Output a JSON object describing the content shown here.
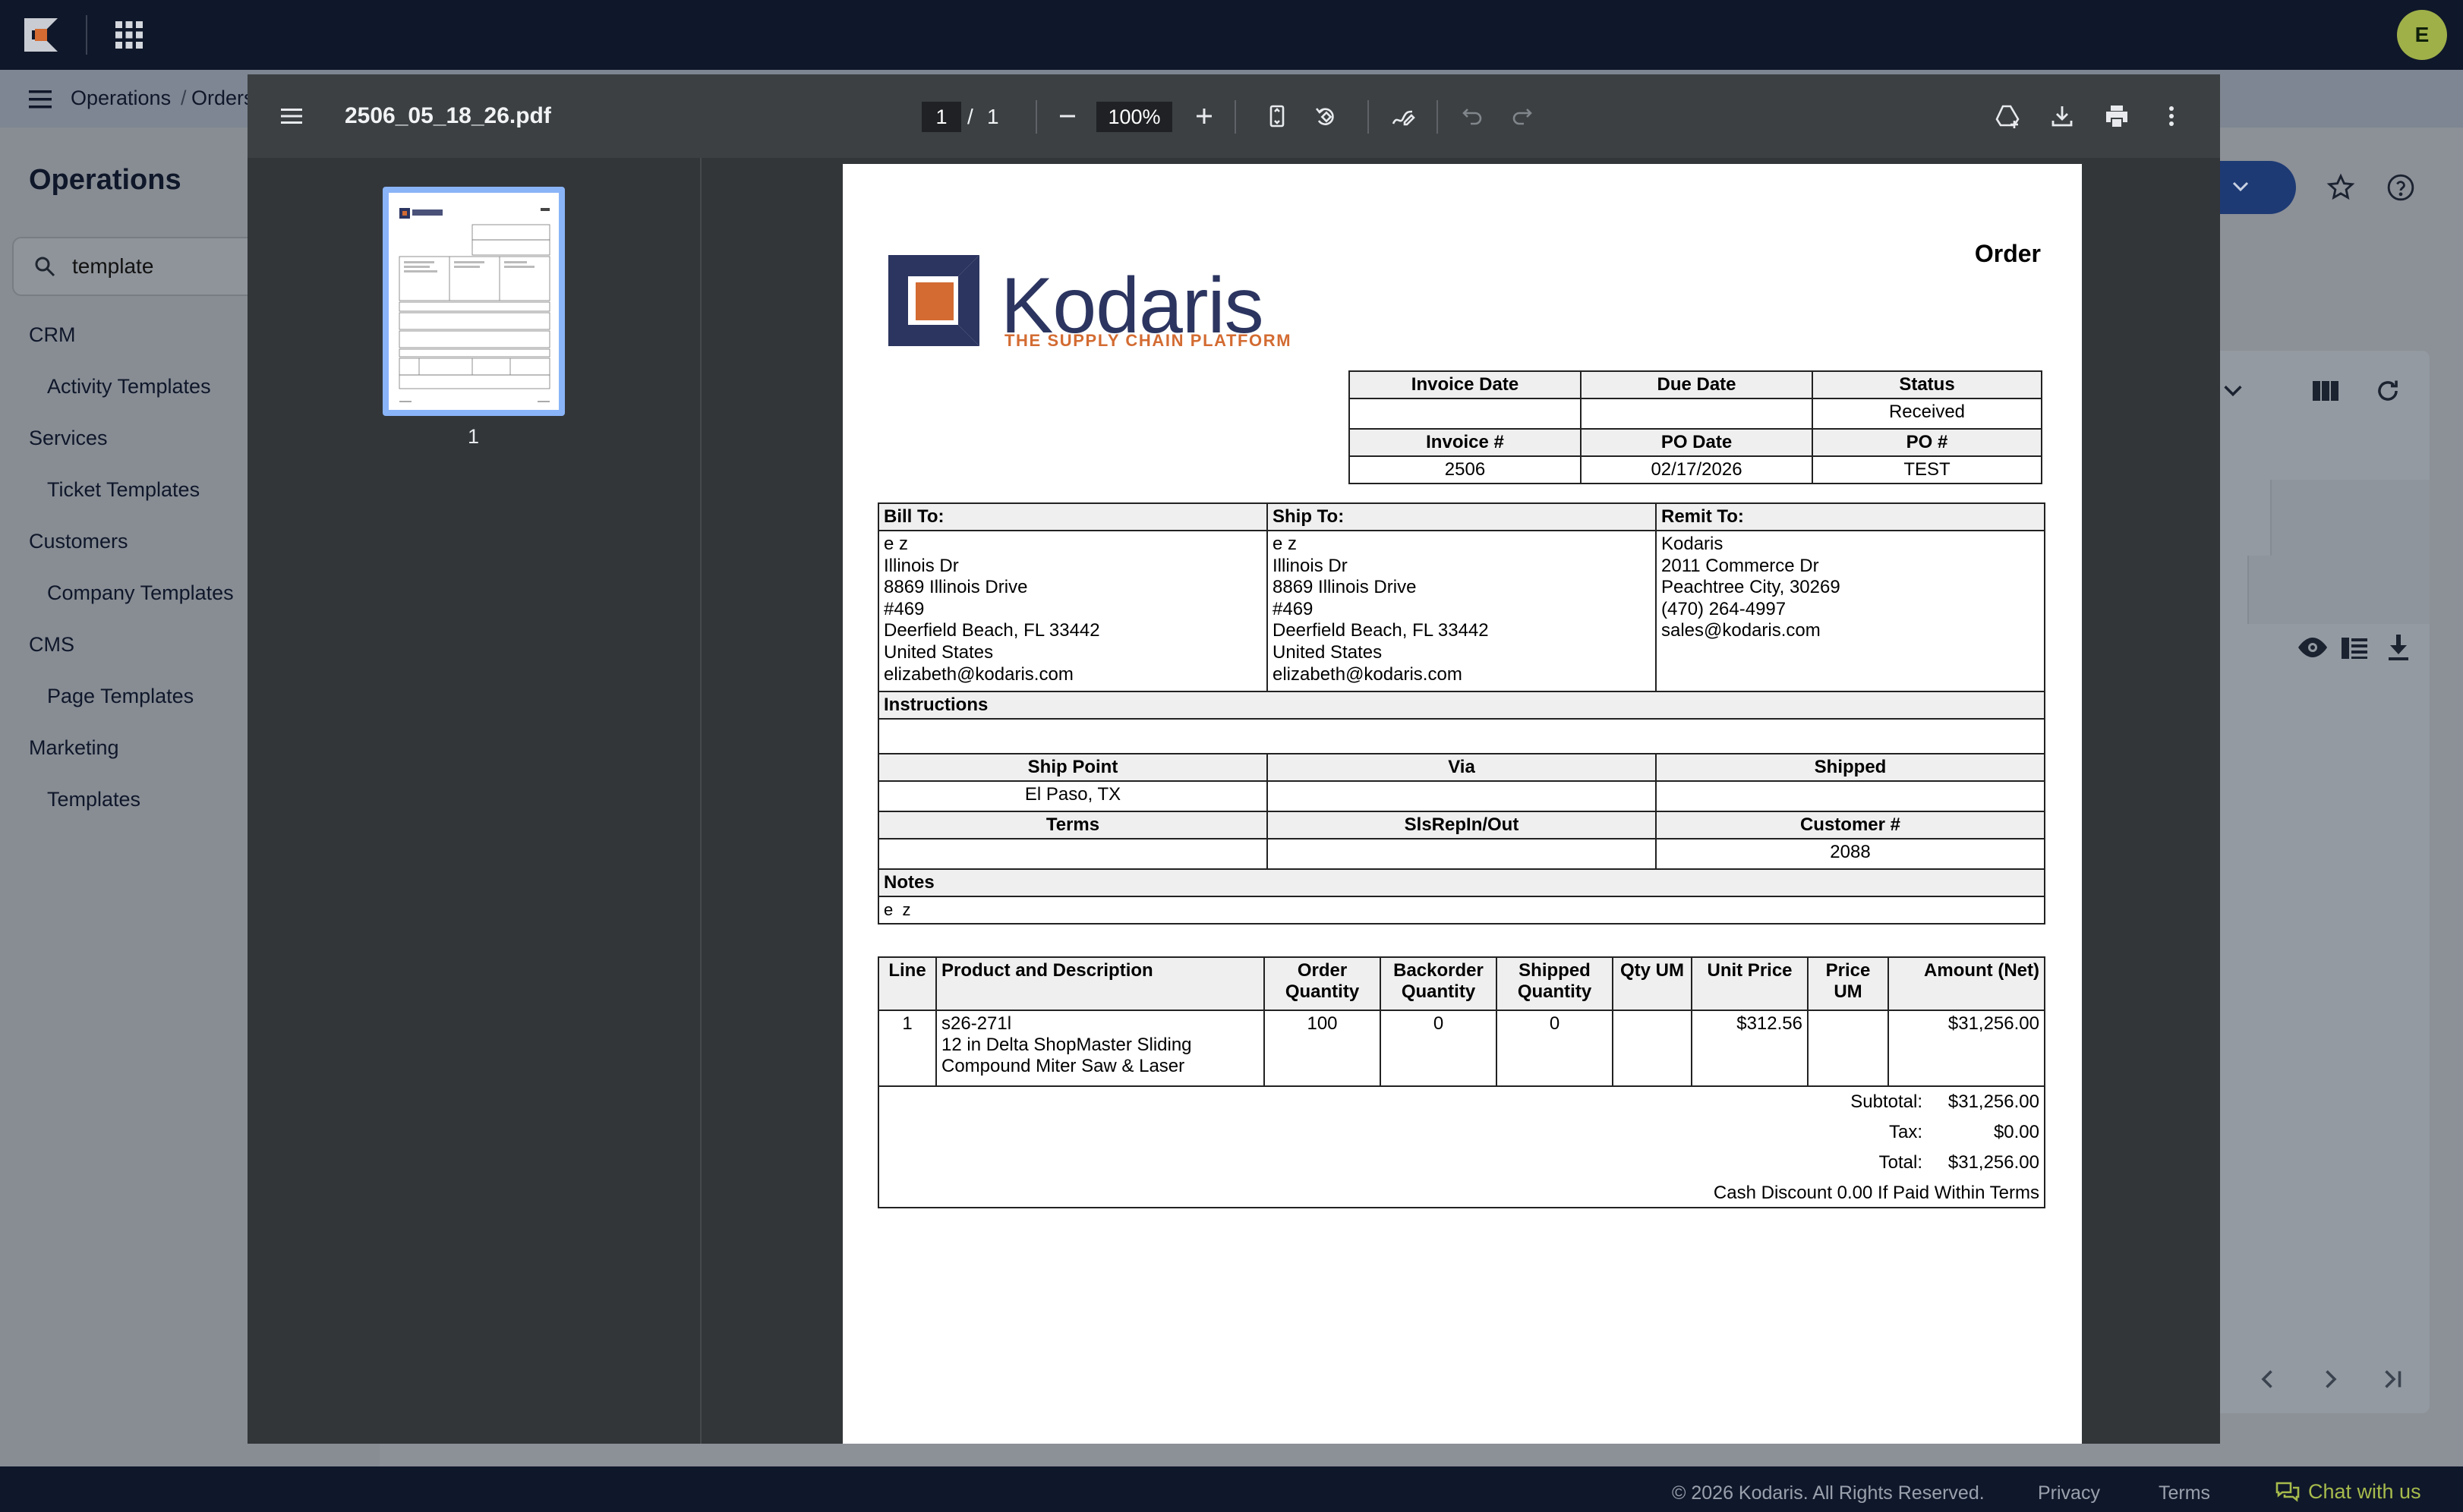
{
  "app": {
    "avatar_initial": "E",
    "breadcrumb": [
      "Operations",
      "/",
      "Orders"
    ]
  },
  "sidebar": {
    "title": "Operations",
    "search_value": "template",
    "groups": [
      {
        "label": "CRM",
        "items": [
          "Activity Templates"
        ]
      },
      {
        "label": "Services",
        "items": [
          "Ticket Templates"
        ]
      },
      {
        "label": "Customers",
        "items": [
          "Company Templates"
        ]
      },
      {
        "label": "CMS",
        "items": [
          "Page Templates"
        ]
      },
      {
        "label": "Marketing",
        "items": [
          "Templates"
        ]
      }
    ]
  },
  "footer": {
    "copyright": "© 2026 Kodaris. All Rights Reserved.",
    "privacy": "Privacy",
    "terms": "Terms",
    "chat": "Chat with us"
  },
  "viewer": {
    "filename": "2506_05_18_26.pdf",
    "current_page": "1",
    "page_sep": "/",
    "total_pages": "1",
    "zoom": "100%",
    "thumb_label": "1"
  },
  "doc": {
    "brand": "Kodaris",
    "tagline": "THE SUPPLY CHAIN PLATFORM",
    "doc_title": "Order",
    "meta_headers": [
      "Invoice Date",
      "Due Date",
      "Status"
    ],
    "meta_values": [
      "",
      "",
      "Received"
    ],
    "meta_headers2": [
      "Invoice #",
      "PO Date",
      "PO #"
    ],
    "meta_values2": [
      "2506",
      "02/17/2026",
      "TEST"
    ],
    "bill_to_label": "Bill To:",
    "ship_to_label": "Ship To:",
    "remit_to_label": "Remit To:",
    "bill_to": [
      "e z",
      "Illinois Dr",
      "8869 Illinois Drive",
      "#469",
      "Deerfield Beach, FL 33442",
      "United States",
      "elizabeth@kodaris.com"
    ],
    "ship_to": [
      "e z",
      "Illinois Dr",
      "8869 Illinois Drive",
      "#469",
      "Deerfield Beach, FL 33442",
      "United States",
      "elizabeth@kodaris.com"
    ],
    "remit_to": [
      "Kodaris",
      "2011 Commerce Dr",
      "Peachtree City, 30269",
      "(470) 264-4997",
      "sales@kodaris.com"
    ],
    "instructions_label": "Instructions",
    "instructions": "",
    "ship_headers": [
      "Ship Point",
      "Via",
      "Shipped"
    ],
    "ship_values": [
      "El Paso, TX",
      "",
      ""
    ],
    "terms_headers": [
      "Terms",
      "SlsRepIn/Out",
      "Customer #"
    ],
    "terms_values": [
      "",
      "",
      "2088"
    ],
    "notes_label": "Notes",
    "notes": "e  z",
    "line_headers": [
      "Line",
      "Product and Description",
      "Order Quantity",
      "Backorder Quantity",
      "Shipped Quantity",
      "Qty UM",
      "Unit Price",
      "Price UM",
      "Amount (Net)"
    ],
    "lines": [
      {
        "line": "1",
        "sku": "s26-271l",
        "desc1": "12 in Delta ShopMaster Sliding",
        "desc2": "Compound Miter Saw & Laser",
        "order_qty": "100",
        "backorder_qty": "0",
        "shipped_qty": "0",
        "qty_um": "",
        "unit_price": "$312.56",
        "price_um": "",
        "amount": "$31,256.00"
      }
    ],
    "subtotal_label": "Subtotal:",
    "subtotal": "$31,256.00",
    "tax_label": "Tax:",
    "tax": "$0.00",
    "total_label": "Total:",
    "total": "$31,256.00",
    "discount_note": "Cash Discount 0.00 If Paid Within Terms"
  }
}
